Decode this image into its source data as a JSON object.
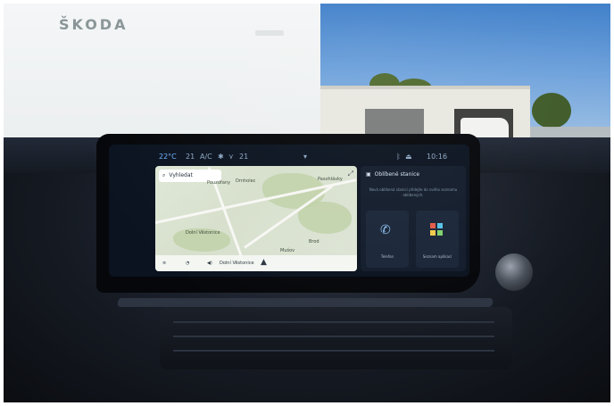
{
  "outside": {
    "brand_text": "ŠKODA"
  },
  "status_bar": {
    "temp_left": "22°C",
    "fan_left": "21",
    "ac_label": "A/C",
    "fan_right": "21",
    "time": "10:16"
  },
  "map": {
    "search_label": "Vyhledat",
    "places": [
      "Dolní Věstonice",
      "Pouzdřany",
      "Drnholec",
      "Pasohlávky",
      "Mušov",
      "Dolní Dunajovice",
      "Brod"
    ],
    "bottom_labels": [
      "Dolní Věstonice"
    ],
    "accent_road": "#f7f7f4",
    "water": "#9cb8cf"
  },
  "panel": {
    "title": "Oblíbené stanice",
    "description": "Nová oblíbená stanici přidejte do svého seznamu oblíbených.",
    "tiles": [
      {
        "label": "Telefon",
        "icon": "phone-icon"
      },
      {
        "label": "Seznam aplikací",
        "icon": "app-grid-icon"
      }
    ]
  },
  "colors": {
    "screen_bg": "#0b1320",
    "accent": "#8fc1f0",
    "panel_bg": "#121c2b"
  }
}
